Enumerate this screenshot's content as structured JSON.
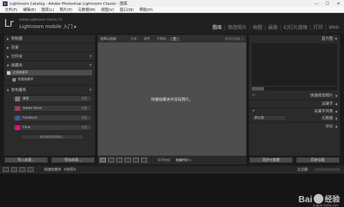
{
  "window": {
    "app_icon": "lr",
    "title": "Lightroom Catalog - Adobe Photoshop Lightroom Classic - 图库",
    "controls": [
      "—",
      "☐",
      "✕"
    ]
  },
  "menubar": [
    "文件(F)",
    "编辑(E)",
    "图库(L)",
    "照片(P)",
    "元数据(M)",
    "视图(V)",
    "窗口(W)",
    "帮助(H)"
  ],
  "identity": {
    "logo": "Lr",
    "product": "Adobe Lightroom Classic CC",
    "mobile": "Lightroom mobile 入门 ▸"
  },
  "modules": [
    "图库",
    "修改照片",
    "地图",
    "画册",
    "幻灯片放映",
    "打印",
    "Web"
  ],
  "active_module": "图库",
  "left_panel": {
    "navigator": "导航器",
    "catalog": "目录",
    "folders": "文件夹",
    "collections": "收藏夹",
    "collection_items": [
      {
        "label": "过滤收藏夹",
        "selected": true
      },
      {
        "label": "智能收藏夹",
        "selected": false
      }
    ],
    "publish": "发布服务",
    "publish_items": [
      {
        "label": "硬盘",
        "icon": "hard-drive",
        "color": "#7a7a7a",
        "set": "设置..."
      },
      {
        "label": "Adobe Stock",
        "icon": "adobe-stock",
        "color": "#b0335c",
        "set": "设置..."
      },
      {
        "label": "Facebook",
        "icon": "facebook",
        "color": "#3b5998",
        "set": "设置..."
      },
      {
        "label": "Flickr",
        "icon": "flickr",
        "color": "#ff0084",
        "set": "设置..."
      }
    ],
    "find_more": "联机查找更多服务...",
    "import_btn": "导入目录...",
    "export_btn": "导出目录..."
  },
  "right_panel": {
    "histogram": "直方图",
    "quick_develop": "快速修改照片",
    "keywording": "关键字",
    "keyword_list": "关键字列表",
    "metadata": "元数据",
    "metadata_preset": "默认值",
    "comments": "评论",
    "sync_metadata": "同步元数据",
    "sync_settings": "同步设置"
  },
  "center": {
    "filter_title": "图库过滤器：",
    "filter_options": [
      "文本",
      "属性",
      "元数据",
      "无"
    ],
    "filter_active": "无",
    "filter_right": "关闭过滤器 ◇",
    "empty_message": "快捷收藏夹中没有照片。"
  },
  "toolbar": {
    "sort_label": "排序依据：",
    "sort_value": "拍摄时间 ◇"
  },
  "filmstrip": {
    "source": "快捷收藏夹",
    "count": "0张照片",
    "filter_label": "过滤器："
  },
  "watermark": {
    "text": "Bai",
    "cn": "经验",
    "url": "jingyan.baidu.com"
  }
}
